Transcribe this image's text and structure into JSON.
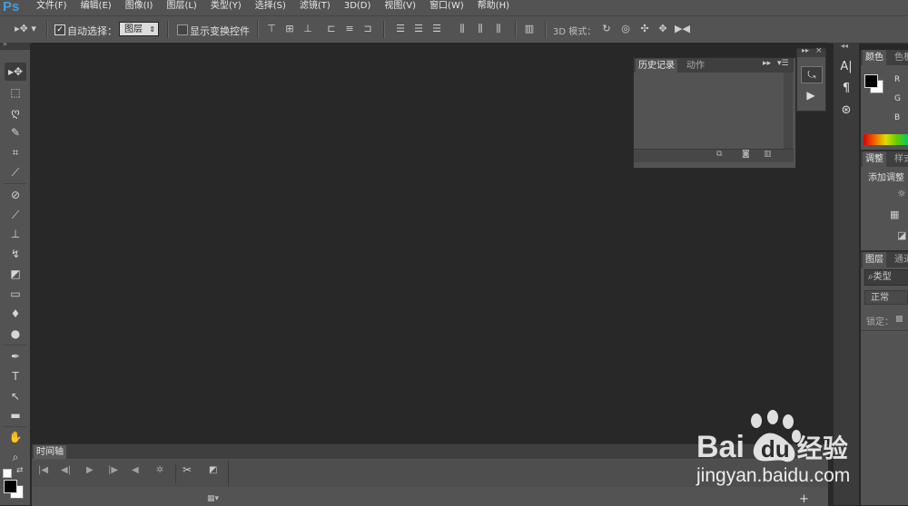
{
  "app": {
    "logo": "Ps"
  },
  "menu": [
    "文件(F)",
    "编辑(E)",
    "图像(I)",
    "图层(L)",
    "类型(Y)",
    "选择(S)",
    "滤镜(T)",
    "3D(D)",
    "视图(V)",
    "窗口(W)",
    "帮助(H)"
  ],
  "options": {
    "auto_select_label": "自动选择：",
    "auto_select_checked": true,
    "layer_select_value": "图层",
    "show_transform_label": "显示变换控件",
    "mode_3d_label": "3D 模式："
  },
  "history_panel": {
    "tab_history": "历史记录",
    "tab_actions": "动作"
  },
  "right_panels": {
    "color_tabs": [
      "颜色",
      "色板"
    ],
    "channels": [
      "R",
      "G",
      "B"
    ],
    "adjust_tabs": [
      "调整",
      "样式"
    ],
    "adjust_add_label": "添加调整",
    "layers_tabs": [
      "图层",
      "通道"
    ],
    "layer_filter_placeholder": "类型",
    "blend_mode": "正常",
    "lock_label": "锁定："
  },
  "timeline": {
    "tab_label": "时间轴"
  },
  "watermark": {
    "brand_latin": "Bai",
    "brand_du": "du",
    "brand_suffix": "经验",
    "url": "jingyan.baidu.com"
  },
  "colors": {
    "panel": "#535353",
    "canvas": "#282828",
    "dark": "#3b3b3b",
    "accent": "#4a9ad8"
  },
  "icons": [
    "move-tool-icon",
    "marquee-tool-icon",
    "lasso-tool-icon",
    "quick-select-tool-icon",
    "crop-tool-icon",
    "eyedropper-tool-icon",
    "healing-brush-tool-icon",
    "brush-tool-icon",
    "clone-stamp-tool-icon",
    "history-brush-tool-icon",
    "eraser-tool-icon",
    "gradient-tool-icon",
    "blur-tool-icon",
    "dodge-tool-icon",
    "pen-tool-icon",
    "type-tool-icon",
    "path-select-tool-icon",
    "rectangle-tool-icon",
    "hand-tool-icon",
    "zoom-tool-icon"
  ]
}
